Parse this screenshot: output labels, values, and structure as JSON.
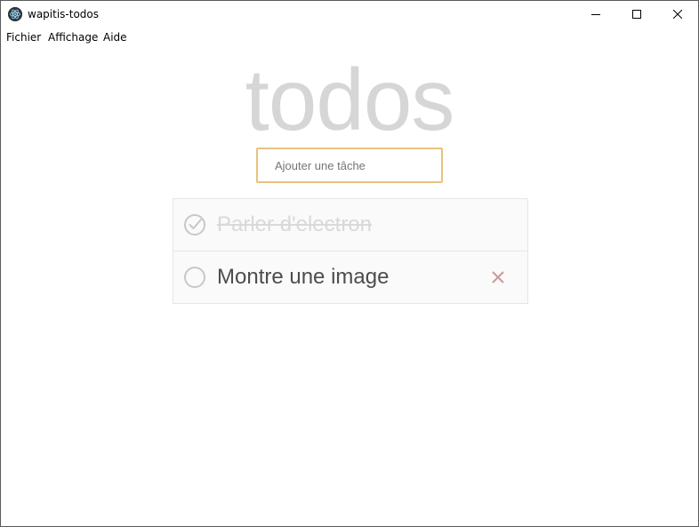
{
  "window": {
    "title": "wapitis-todos"
  },
  "menu": {
    "items": [
      {
        "label": "Fichier"
      },
      {
        "label": "Affichage"
      },
      {
        "label": "Aide"
      }
    ]
  },
  "app": {
    "heading": "todos",
    "new_todo": {
      "placeholder": "Ajouter une tâche",
      "value": ""
    },
    "todos": [
      {
        "label": "Parler d'electron",
        "completed": true
      },
      {
        "label": "Montre une image",
        "completed": false
      }
    ]
  },
  "icons": {
    "app": "electron-icon",
    "minimize": "minimize-icon",
    "maximize": "maximize-icon",
    "close": "close-icon",
    "toggle_checked": "check-circle-icon",
    "toggle_unchecked": "circle-icon",
    "destroy": "x-icon"
  },
  "colors": {
    "heading": "#d6d6d6",
    "input_border": "#e9c27e",
    "destroy": "#cc9a9a",
    "check": "#c8c8c8"
  }
}
